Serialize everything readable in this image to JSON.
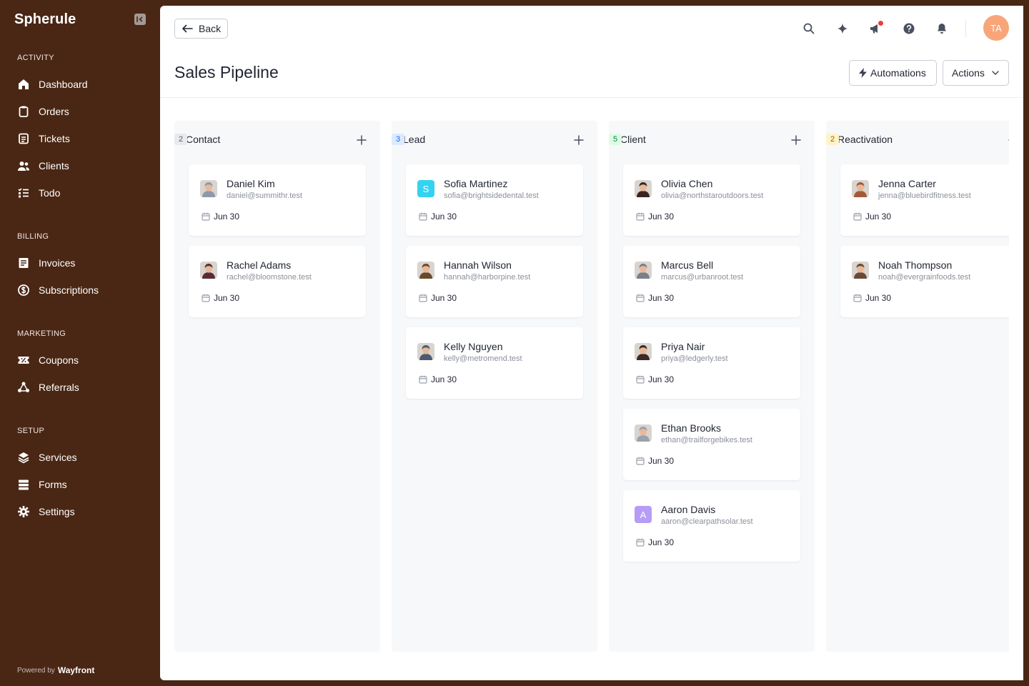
{
  "app": {
    "brand": "Spherule"
  },
  "sidebar": {
    "sections": [
      {
        "label": "ACTIVITY",
        "items": [
          {
            "label": "Dashboard",
            "icon": "home-icon"
          },
          {
            "label": "Orders",
            "icon": "clipboard-icon"
          },
          {
            "label": "Tickets",
            "icon": "ticket-icon"
          },
          {
            "label": "Clients",
            "icon": "users-icon"
          },
          {
            "label": "Todo",
            "icon": "checklist-icon"
          }
        ]
      },
      {
        "label": "BILLING",
        "items": [
          {
            "label": "Invoices",
            "icon": "invoice-icon"
          },
          {
            "label": "Subscriptions",
            "icon": "dollar-cycle-icon"
          }
        ]
      },
      {
        "label": "MARKETING",
        "items": [
          {
            "label": "Coupons",
            "icon": "coupon-icon"
          },
          {
            "label": "Referrals",
            "icon": "referral-icon"
          }
        ]
      },
      {
        "label": "SETUP",
        "items": [
          {
            "label": "Services",
            "icon": "layers-icon"
          },
          {
            "label": "Forms",
            "icon": "forms-icon"
          },
          {
            "label": "Settings",
            "icon": "gear-icon"
          }
        ]
      }
    ],
    "powered_by": "Powered by",
    "powered_brand": "Wayfront"
  },
  "topbar": {
    "back_label": "Back",
    "user_initials": "TA",
    "icons": [
      "search-icon",
      "sparkle-icon",
      "megaphone-icon",
      "help-icon",
      "bell-icon"
    ]
  },
  "page": {
    "title": "Sales Pipeline",
    "automations_label": "Automations",
    "actions_label": "Actions"
  },
  "colors": {
    "sidebar_bg": "#4a2714",
    "avatar_bg": "#f8a57a",
    "notification_dot": "#ef3b3b"
  },
  "board": {
    "columns": [
      {
        "title": "Contact",
        "count": "2",
        "badge_bg": "#e8eaee",
        "badge_fg": "#5b6170",
        "cards": [
          {
            "name": "Daniel Kim",
            "email": "daniel@summithr.test",
            "date": "Jun 30",
            "avatar": "photo",
            "tone": "#8d99a8"
          },
          {
            "name": "Rachel Adams",
            "email": "rachel@bloomstone.test",
            "date": "Jun 30",
            "avatar": "photo",
            "tone": "#5a2d36"
          }
        ]
      },
      {
        "title": "Lead",
        "count": "3",
        "badge_bg": "#dbeafe",
        "badge_fg": "#2563eb",
        "cards": [
          {
            "name": "Sofia Martinez",
            "email": "sofia@brightsidedental.test",
            "date": "Jun 30",
            "avatar": "letter",
            "letter": "S",
            "tone": "#34d3f0"
          },
          {
            "name": "Hannah Wilson",
            "email": "hannah@harborpine.test",
            "date": "Jun 30",
            "avatar": "photo",
            "tone": "#6b4a2a"
          },
          {
            "name": "Kelly Nguyen",
            "email": "kelly@metromend.test",
            "date": "Jun 30",
            "avatar": "photo",
            "tone": "#4e5a6e"
          }
        ]
      },
      {
        "title": "Client",
        "count": "5",
        "badge_bg": "#dcfce7",
        "badge_fg": "#15803d",
        "cards": [
          {
            "name": "Olivia Chen",
            "email": "olivia@northstaroutdoors.test",
            "date": "Jun 30",
            "avatar": "photo",
            "tone": "#3a2620"
          },
          {
            "name": "Marcus Bell",
            "email": "marcus@urbanroot.test",
            "date": "Jun 30",
            "avatar": "photo",
            "tone": "#7a7f88"
          },
          {
            "name": "Priya Nair",
            "email": "priya@ledgerly.test",
            "date": "Jun 30",
            "avatar": "photo",
            "tone": "#3b2b22"
          },
          {
            "name": "Ethan Brooks",
            "email": "ethan@trailforgebikes.test",
            "date": "Jun 30",
            "avatar": "photo",
            "tone": "#9aa2ab"
          },
          {
            "name": "Aaron Davis",
            "email": "aaron@clearpathsolar.test",
            "date": "Jun 30",
            "avatar": "letter",
            "letter": "A",
            "tone": "#b69cf5"
          }
        ]
      },
      {
        "title": "Reactivation",
        "count": "2",
        "badge_bg": "#fef3c7",
        "badge_fg": "#a16207",
        "cards": [
          {
            "name": "Jenna Carter",
            "email": "jenna@bluebirdfitness.test",
            "date": "Jun 30",
            "avatar": "photo",
            "tone": "#a35a3a"
          },
          {
            "name": "Noah Thompson",
            "email": "noah@evergrainfoods.test",
            "date": "Jun 30",
            "avatar": "photo",
            "tone": "#6a4a36"
          }
        ]
      }
    ]
  }
}
